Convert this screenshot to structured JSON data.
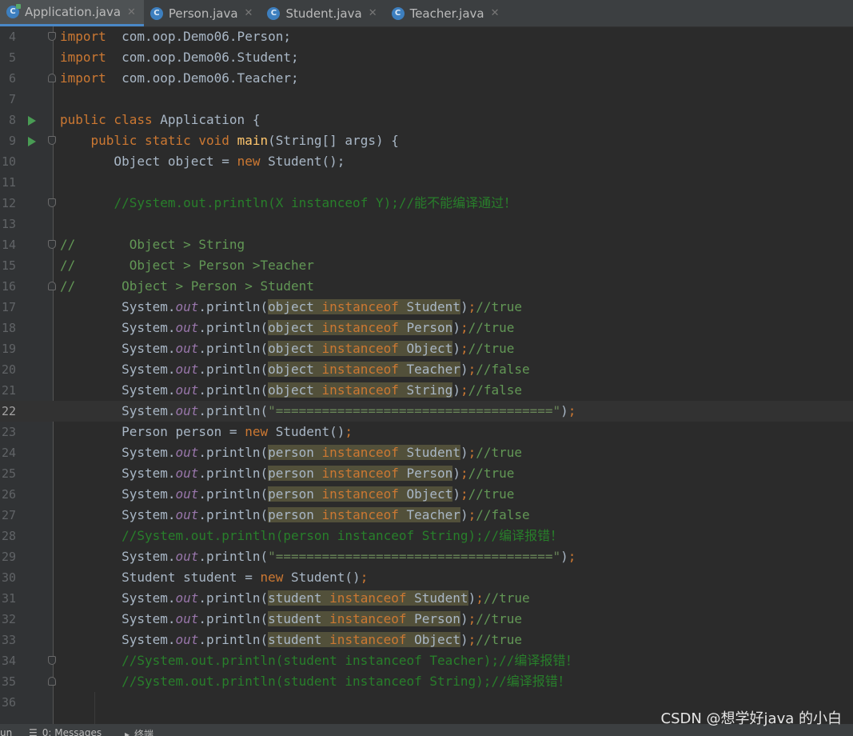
{
  "tabs": [
    {
      "label": "Application.java",
      "active": true
    },
    {
      "label": "Person.java",
      "active": false
    },
    {
      "label": "Student.java",
      "active": false
    },
    {
      "label": "Teacher.java",
      "active": false
    }
  ],
  "tab_icon_letter": "C",
  "close_glyph": "✕",
  "colors": {
    "background": "#2b2b2b",
    "keyword": "#cc7832",
    "method": "#ffc66d",
    "comment": "#629755",
    "string": "#6a8759",
    "static_field": "#9876aa",
    "highlight": "#52503a"
  },
  "editor": {
    "current_line": "22",
    "lines": [
      {
        "n": "4",
        "fold": "down",
        "tokens": [
          [
            "kw",
            "import"
          ],
          [
            "",
            "  com.oop.Demo06.Person;"
          ]
        ]
      },
      {
        "n": "5",
        "tokens": [
          [
            "kw",
            "import"
          ],
          [
            "",
            "  com.oop.Demo06.Student;"
          ]
        ]
      },
      {
        "n": "6",
        "fold": "up",
        "tokens": [
          [
            "kw",
            "import"
          ],
          [
            "",
            "  com.oop.Demo06.Teacher;"
          ]
        ]
      },
      {
        "n": "7",
        "tokens": []
      },
      {
        "n": "8",
        "run": true,
        "tokens": [
          [
            "kw",
            "public class"
          ],
          [
            "",
            " Application {"
          ]
        ]
      },
      {
        "n": "9",
        "run": true,
        "fold": "down",
        "tokens": [
          [
            "",
            "    "
          ],
          [
            "kw",
            "public static void"
          ],
          [
            "",
            " "
          ],
          [
            "fn",
            "main"
          ],
          [
            "",
            "(String[] args) {"
          ]
        ]
      },
      {
        "n": "10",
        "tokens": [
          [
            "",
            "       Object object = "
          ],
          [
            "kw",
            "new"
          ],
          [
            "",
            " Student();"
          ]
        ]
      },
      {
        "n": "11",
        "tokens": []
      },
      {
        "n": "12",
        "fold": "down",
        "tokens": [
          [
            "",
            "       "
          ],
          [
            "cmg",
            "//System.out.println(X instanceof Y);//能不能编译通过！"
          ]
        ]
      },
      {
        "n": "13",
        "tokens": []
      },
      {
        "n": "14",
        "fold": "down",
        "tokens": [
          [
            "cm",
            "//       Object > String"
          ]
        ]
      },
      {
        "n": "15",
        "tokens": [
          [
            "cm",
            "//       Object > Person >Teacher"
          ]
        ]
      },
      {
        "n": "16",
        "fold": "up",
        "tokens": [
          [
            "cm",
            "//      Object > Person > Student"
          ]
        ]
      },
      {
        "n": "17",
        "tokens": [
          [
            "",
            "        System."
          ],
          [
            "fld",
            "out"
          ],
          [
            "",
            ".println("
          ],
          [
            "hl",
            "object "
          ],
          [
            "hlkw",
            "instanceof"
          ],
          [
            "hl",
            " Student"
          ],
          [
            "",
            ")"
          ],
          [
            "kw",
            ";"
          ],
          [
            "cm",
            "//true"
          ]
        ]
      },
      {
        "n": "18",
        "tokens": [
          [
            "",
            "        System."
          ],
          [
            "fld",
            "out"
          ],
          [
            "",
            ".println("
          ],
          [
            "hl",
            "object "
          ],
          [
            "hlkw",
            "instanceof"
          ],
          [
            "hl",
            " Person"
          ],
          [
            "",
            ")"
          ],
          [
            "kw",
            ";"
          ],
          [
            "cm",
            "//true"
          ]
        ]
      },
      {
        "n": "19",
        "tokens": [
          [
            "",
            "        System."
          ],
          [
            "fld",
            "out"
          ],
          [
            "",
            ".println("
          ],
          [
            "hl",
            "object "
          ],
          [
            "hlkw",
            "instanceof"
          ],
          [
            "hl",
            " Object"
          ],
          [
            "",
            ")"
          ],
          [
            "kw",
            ";"
          ],
          [
            "cm",
            "//true"
          ]
        ]
      },
      {
        "n": "20",
        "tokens": [
          [
            "",
            "        System."
          ],
          [
            "fld",
            "out"
          ],
          [
            "",
            ".println("
          ],
          [
            "hl",
            "object "
          ],
          [
            "hlkw",
            "instanceof"
          ],
          [
            "hl",
            " Teacher"
          ],
          [
            "",
            ")"
          ],
          [
            "kw",
            ";"
          ],
          [
            "cm",
            "//false"
          ]
        ]
      },
      {
        "n": "21",
        "tokens": [
          [
            "",
            "        System."
          ],
          [
            "fld",
            "out"
          ],
          [
            "",
            ".println("
          ],
          [
            "hl",
            "object "
          ],
          [
            "hlkw",
            "instanceof"
          ],
          [
            "hl",
            " String"
          ],
          [
            "",
            ")"
          ],
          [
            "kw",
            ";"
          ],
          [
            "cm",
            "//false"
          ]
        ]
      },
      {
        "n": "22",
        "tokens": [
          [
            "",
            "        System."
          ],
          [
            "fld",
            "out"
          ],
          [
            "",
            ".println("
          ],
          [
            "st",
            "\"====================================\""
          ],
          [
            "",
            ")"
          ],
          [
            "kw",
            ";"
          ]
        ]
      },
      {
        "n": "23",
        "tokens": [
          [
            "",
            "        Person person = "
          ],
          [
            "kw",
            "new"
          ],
          [
            "",
            " Student()"
          ],
          [
            "kw",
            ";"
          ]
        ]
      },
      {
        "n": "24",
        "tokens": [
          [
            "",
            "        System."
          ],
          [
            "fld",
            "out"
          ],
          [
            "",
            ".println("
          ],
          [
            "hl",
            "person "
          ],
          [
            "hlkw",
            "instanceof"
          ],
          [
            "hl",
            " Student"
          ],
          [
            "",
            ")"
          ],
          [
            "kw",
            ";"
          ],
          [
            "cm",
            "//true"
          ]
        ]
      },
      {
        "n": "25",
        "tokens": [
          [
            "",
            "        System."
          ],
          [
            "fld",
            "out"
          ],
          [
            "",
            ".println("
          ],
          [
            "hl",
            "person "
          ],
          [
            "hlkw",
            "instanceof"
          ],
          [
            "hl",
            " Person"
          ],
          [
            "",
            ")"
          ],
          [
            "kw",
            ";"
          ],
          [
            "cm",
            "//true"
          ]
        ]
      },
      {
        "n": "26",
        "tokens": [
          [
            "",
            "        System."
          ],
          [
            "fld",
            "out"
          ],
          [
            "",
            ".println("
          ],
          [
            "hl",
            "person "
          ],
          [
            "hlkw",
            "instanceof"
          ],
          [
            "hl",
            " Object"
          ],
          [
            "",
            ")"
          ],
          [
            "kw",
            ";"
          ],
          [
            "cm",
            "//true"
          ]
        ]
      },
      {
        "n": "27",
        "tokens": [
          [
            "",
            "        System."
          ],
          [
            "fld",
            "out"
          ],
          [
            "",
            ".println("
          ],
          [
            "hl",
            "person "
          ],
          [
            "hlkw",
            "instanceof"
          ],
          [
            "hl",
            " Teacher"
          ],
          [
            "",
            ")"
          ],
          [
            "kw",
            ";"
          ],
          [
            "cm",
            "//false"
          ]
        ]
      },
      {
        "n": "28",
        "tokens": [
          [
            "",
            "        "
          ],
          [
            "cmg",
            "//System.out.println(person instanceof String);//编译报错！"
          ]
        ]
      },
      {
        "n": "29",
        "tokens": [
          [
            "",
            "        System."
          ],
          [
            "fld",
            "out"
          ],
          [
            "",
            ".println("
          ],
          [
            "st",
            "\"====================================\""
          ],
          [
            "",
            ")"
          ],
          [
            "kw",
            ";"
          ]
        ]
      },
      {
        "n": "30",
        "tokens": [
          [
            "",
            "        Student student = "
          ],
          [
            "kw",
            "new"
          ],
          [
            "",
            " Student()"
          ],
          [
            "kw",
            ";"
          ]
        ]
      },
      {
        "n": "31",
        "tokens": [
          [
            "",
            "        System."
          ],
          [
            "fld",
            "out"
          ],
          [
            "",
            ".println("
          ],
          [
            "hl",
            "student "
          ],
          [
            "hlkw",
            "instanceof"
          ],
          [
            "hl",
            " Student"
          ],
          [
            "",
            ")"
          ],
          [
            "kw",
            ";"
          ],
          [
            "cm",
            "//true"
          ]
        ]
      },
      {
        "n": "32",
        "tokens": [
          [
            "",
            "        System."
          ],
          [
            "fld",
            "out"
          ],
          [
            "",
            ".println("
          ],
          [
            "hl",
            "student "
          ],
          [
            "hlkw",
            "instanceof"
          ],
          [
            "hl",
            " Person"
          ],
          [
            "",
            ")"
          ],
          [
            "kw",
            ";"
          ],
          [
            "cm",
            "//true"
          ]
        ]
      },
      {
        "n": "33",
        "tokens": [
          [
            "",
            "        System."
          ],
          [
            "fld",
            "out"
          ],
          [
            "",
            ".println("
          ],
          [
            "hl",
            "student "
          ],
          [
            "hlkw",
            "instanceof"
          ],
          [
            "hl",
            " Object"
          ],
          [
            "",
            ")"
          ],
          [
            "kw",
            ";"
          ],
          [
            "cm",
            "//true"
          ]
        ]
      },
      {
        "n": "34",
        "fold": "down",
        "tokens": [
          [
            "",
            "        "
          ],
          [
            "cmg",
            "//System.out.println(student instanceof Teacher);//编译报错！"
          ]
        ]
      },
      {
        "n": "35",
        "fold": "up",
        "tokens": [
          [
            "",
            "        "
          ],
          [
            "cmg",
            "//System.out.println(student instanceof String);//编译报错！"
          ]
        ]
      },
      {
        "n": "36",
        "tokens": []
      }
    ]
  },
  "bottom_bar": {
    "left_fragment": "un",
    "messages_label": "0: Messages",
    "terminal_label": "终端"
  },
  "watermark": "CSDN @想学好java 的小白"
}
